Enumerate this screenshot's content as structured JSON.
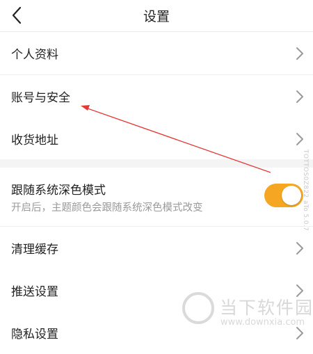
{
  "header": {
    "title": "设置",
    "back_icon": "back-arrow-icon"
  },
  "settings": {
    "items": [
      {
        "label": "个人资料",
        "icon": "chevron-right-icon"
      },
      {
        "label": "账号与安全",
        "icon": "chevron-right-icon"
      },
      {
        "label": "收货地址",
        "icon": "chevron-right-icon"
      }
    ],
    "dark_mode": {
      "label": "跟随系统深色模式",
      "description": "开启后，主题颜色会跟随系统深色模式改变",
      "enabled": true,
      "accent_color": "#f5a623"
    },
    "more_items": [
      {
        "label": "清理缓存",
        "icon": "chevron-right-icon"
      },
      {
        "label": "推送设置",
        "icon": "chevron-right-icon"
      },
      {
        "label": "隐私设置",
        "icon": "chevron-right-icon"
      }
    ]
  },
  "annotation": {
    "arrow_color": "#e53935",
    "icon": "red-arrow-annotation"
  },
  "watermark": {
    "site_name": "当下软件园",
    "site_url": "www.downxia.com",
    "side_text": "TOTTOS0Z822 aTo 5.0.7"
  }
}
